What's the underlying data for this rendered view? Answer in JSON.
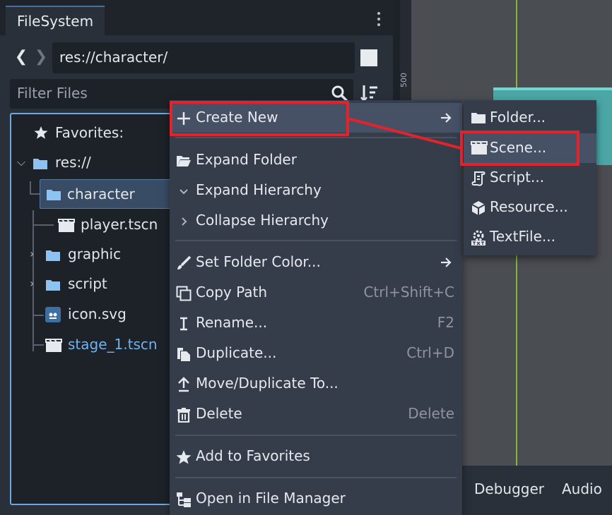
{
  "dock": {
    "tab_label": "FileSystem",
    "path": "res://character/",
    "filter_placeholder": "Filter Files"
  },
  "tree": {
    "favorites": "Favorites:",
    "root": "res://",
    "items": [
      {
        "label": "character",
        "type": "folder",
        "selected": true
      },
      {
        "label": "player.tscn",
        "type": "scene"
      },
      {
        "label": "graphic",
        "type": "folder"
      },
      {
        "label": "script",
        "type": "folder"
      },
      {
        "label": "icon.svg",
        "type": "image"
      },
      {
        "label": "stage_1.tscn",
        "type": "scene",
        "color": "#6fb2ec"
      }
    ]
  },
  "viewport": {
    "ruler_label": "500",
    "bottom_buttons": [
      "Debugger",
      "Audio"
    ]
  },
  "context_menu": {
    "items": [
      {
        "label": "Create New",
        "shortcut": "",
        "icon": "plus-icon",
        "submenu": true
      },
      {
        "label": "Expand Folder",
        "shortcut": "",
        "icon": "folder-open-icon"
      },
      {
        "label": "Expand Hierarchy",
        "shortcut": "",
        "icon": "chevron-down-icon"
      },
      {
        "label": "Collapse Hierarchy",
        "shortcut": "",
        "icon": "chevron-right-icon"
      },
      {
        "label": "Set Folder Color...",
        "shortcut": "",
        "icon": "brush-icon",
        "submenu": true
      },
      {
        "label": "Copy Path",
        "shortcut": "Ctrl+Shift+C",
        "icon": "copy-icon"
      },
      {
        "label": "Rename...",
        "shortcut": "F2",
        "icon": "rename-icon"
      },
      {
        "label": "Duplicate...",
        "shortcut": "Ctrl+D",
        "icon": "duplicate-icon"
      },
      {
        "label": "Move/Duplicate To...",
        "shortcut": "",
        "icon": "move-icon"
      },
      {
        "label": "Delete",
        "shortcut": "Delete",
        "icon": "trash-icon"
      },
      {
        "label": "Add to Favorites",
        "shortcut": "",
        "icon": "star-icon"
      },
      {
        "label": "Open in File Manager",
        "shortcut": "",
        "icon": "file-manager-icon"
      }
    ]
  },
  "submenu": {
    "items": [
      {
        "label": "Folder...",
        "icon": "folder-icon"
      },
      {
        "label": "Scene...",
        "icon": "scene-icon",
        "highlighted": true
      },
      {
        "label": "Script...",
        "icon": "script-icon"
      },
      {
        "label": "Resource...",
        "icon": "resource-icon"
      },
      {
        "label": "TextFile...",
        "icon": "textfile-icon"
      }
    ]
  },
  "colors": {
    "accent": "#6fa8e0",
    "annotation": "#e2232b",
    "folder_icon": "#8cc3f3"
  }
}
